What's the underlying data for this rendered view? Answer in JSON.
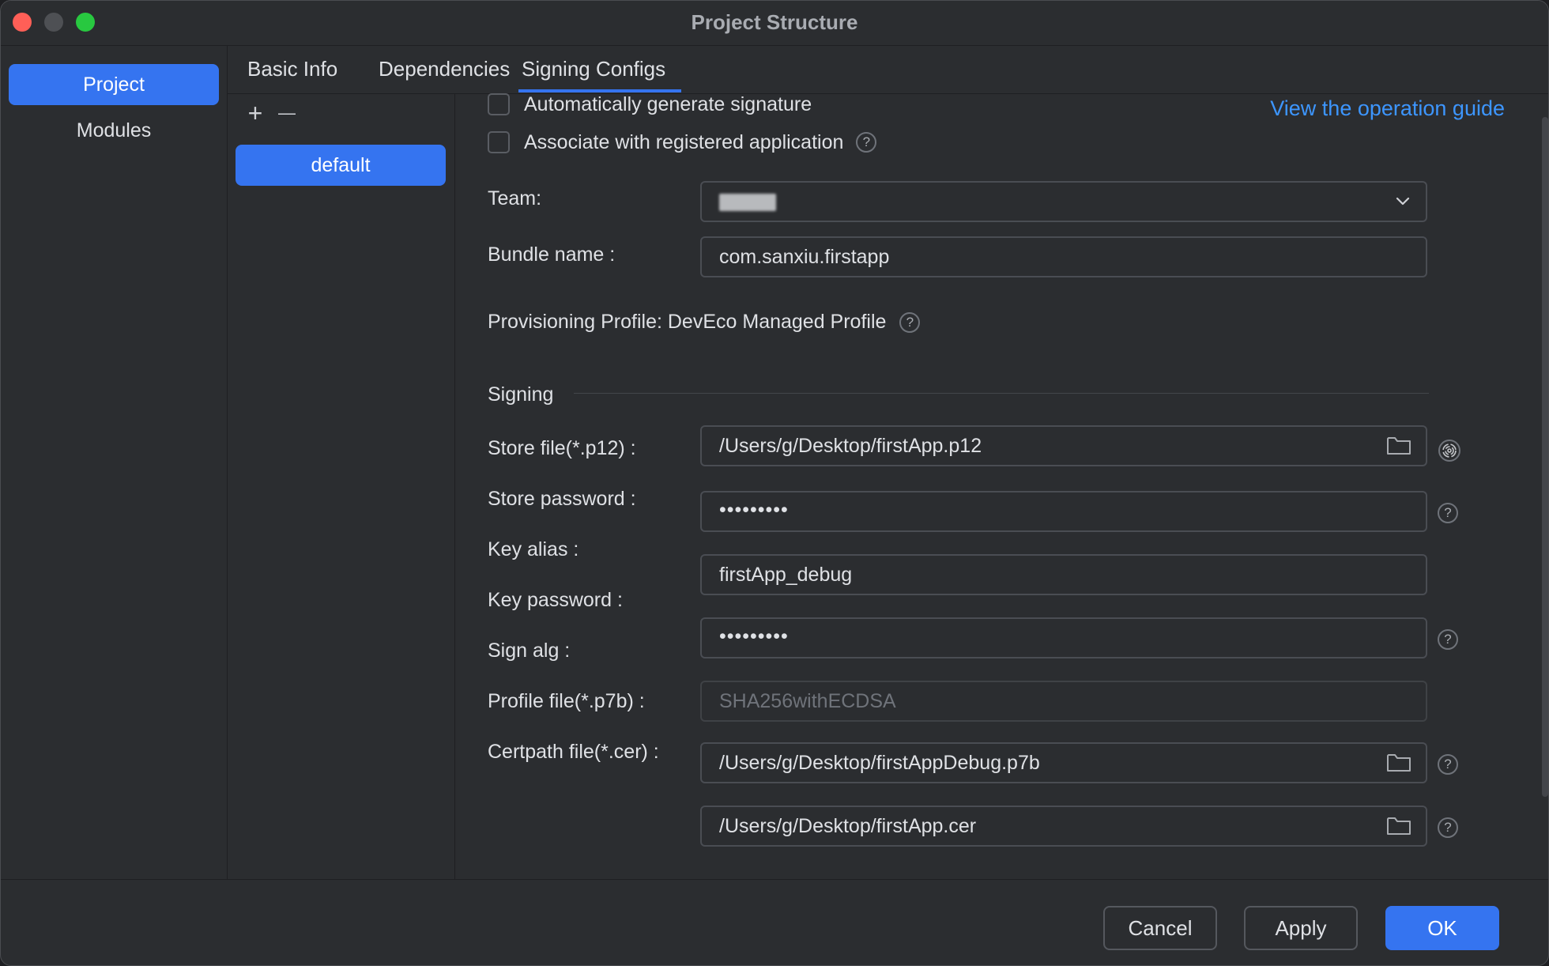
{
  "window": {
    "title": "Project Structure"
  },
  "nav": {
    "project": "Project",
    "modules": "Modules"
  },
  "tabs": {
    "basic_info": "Basic Info",
    "dependencies": "Dependencies",
    "signing_configs": "Signing Configs"
  },
  "config_list": {
    "add_symbol": "+",
    "remove_symbol": "—",
    "items": [
      "default"
    ]
  },
  "options": {
    "auto_sign_label": "Automatically generate signature",
    "auto_sign_checked": false,
    "associate_label": "Associate with registered application",
    "associate_checked": false,
    "guide_link": "View the operation guide",
    "help_symbol": "?"
  },
  "form": {
    "team_label": "Team:",
    "bundle_label": "Bundle name :",
    "bundle_value": "com.sanxiu.firstapp",
    "provisioning_text": "Provisioning Profile: DevEco Managed Profile",
    "signing_section": "Signing",
    "store_file_label": "Store file(*.p12) :",
    "store_file_value": "/Users/g/Desktop/firstApp.p12",
    "store_password_label": "Store password :",
    "store_password_value": "•••••••••",
    "key_alias_label": "Key alias :",
    "key_alias_value": "firstApp_debug",
    "key_password_label": "Key password :",
    "key_password_value": "•••••••••",
    "sign_alg_label": "Sign alg :",
    "sign_alg_value": "SHA256withECDSA",
    "profile_file_label": "Profile file(*.p7b) :",
    "profile_file_value": "/Users/g/Desktop/firstAppDebug.p7b",
    "certpath_label": "Certpath file(*.cer) :",
    "certpath_value": "/Users/g/Desktop/firstApp.cer"
  },
  "footer": {
    "cancel": "Cancel",
    "apply": "Apply",
    "ok": "OK"
  },
  "colors": {
    "accent": "#3574f0",
    "link": "#3d96ff",
    "background": "#2b2d30"
  }
}
